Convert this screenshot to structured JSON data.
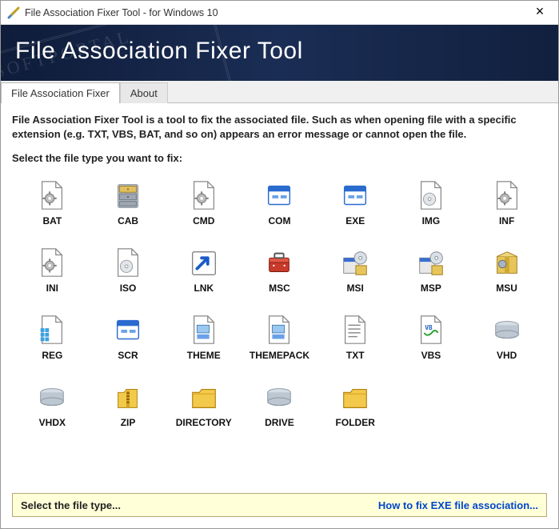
{
  "window": {
    "title": "File Association Fixer Tool - for Windows 10"
  },
  "banner": {
    "title": "File Association Fixer Tool"
  },
  "tabs": [
    {
      "label": "File Association Fixer",
      "active": true
    },
    {
      "label": "About",
      "active": false
    }
  ],
  "description": "File Association Fixer Tool is a tool to fix the associated file. Such as when opening file with a specific extension (e.g. TXT, VBS, BAT, and so on) appears an error message or cannot open the file.",
  "instruction": "Select the file type you want to fix:",
  "items": [
    {
      "label": "BAT",
      "icon": "file-gear"
    },
    {
      "label": "CAB",
      "icon": "cabinet"
    },
    {
      "label": "CMD",
      "icon": "file-gear"
    },
    {
      "label": "COM",
      "icon": "window-app"
    },
    {
      "label": "EXE",
      "icon": "window-app"
    },
    {
      "label": "IMG",
      "icon": "disc-file"
    },
    {
      "label": "INF",
      "icon": "file-gear"
    },
    {
      "label": "INI",
      "icon": "file-gear"
    },
    {
      "label": "ISO",
      "icon": "disc-file"
    },
    {
      "label": "LNK",
      "icon": "shortcut"
    },
    {
      "label": "MSC",
      "icon": "toolbox"
    },
    {
      "label": "MSI",
      "icon": "installer"
    },
    {
      "label": "MSP",
      "icon": "installer"
    },
    {
      "label": "MSU",
      "icon": "package-box"
    },
    {
      "label": "REG",
      "icon": "registry"
    },
    {
      "label": "SCR",
      "icon": "window-app"
    },
    {
      "label": "THEME",
      "icon": "theme"
    },
    {
      "label": "THEMEPACK",
      "icon": "theme"
    },
    {
      "label": "TXT",
      "icon": "text-file"
    },
    {
      "label": "VBS",
      "icon": "script"
    },
    {
      "label": "VHD",
      "icon": "drive"
    },
    {
      "label": "VHDX",
      "icon": "drive"
    },
    {
      "label": "ZIP",
      "icon": "zip"
    },
    {
      "label": "DIRECTORY",
      "icon": "folder"
    },
    {
      "label": "DRIVE",
      "icon": "drive"
    },
    {
      "label": "FOLDER",
      "icon": "folder"
    }
  ],
  "status": {
    "message": "Select the file type...",
    "link": "How to fix EXE file association..."
  },
  "watermark": "SOFTPORTAL"
}
